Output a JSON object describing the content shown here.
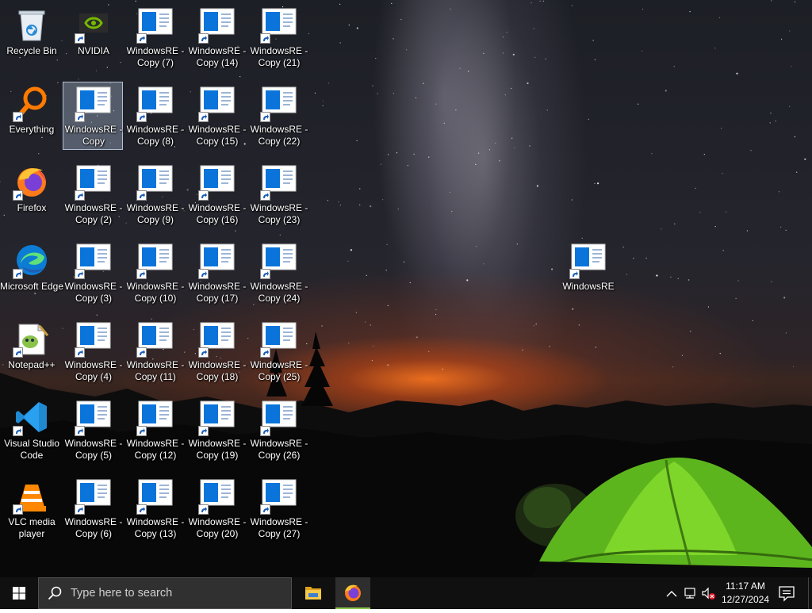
{
  "desktop": {
    "icons": [
      {
        "label": "Recycle Bin",
        "type": "recycle-bin"
      },
      {
        "label": "Everything",
        "type": "everything"
      },
      {
        "label": "Firefox",
        "type": "firefox"
      },
      {
        "label": "Microsoft Edge",
        "type": "edge"
      },
      {
        "label": "Notepad++",
        "type": "notepadpp"
      },
      {
        "label": "Visual Studio Code",
        "type": "vscode"
      },
      {
        "label": "VLC media player",
        "type": "vlc"
      },
      {
        "label": "NVIDIA",
        "type": "nvidia"
      },
      {
        "label": "WindowsRE - Copy",
        "type": "winre",
        "selected": true
      },
      {
        "label": "WindowsRE - Copy (2)",
        "type": "winre"
      },
      {
        "label": "WindowsRE - Copy (3)",
        "type": "winre"
      },
      {
        "label": "WindowsRE - Copy (4)",
        "type": "winre"
      },
      {
        "label": "WindowsRE - Copy (5)",
        "type": "winre"
      },
      {
        "label": "WindowsRE - Copy (6)",
        "type": "winre"
      },
      {
        "label": "WindowsRE - Copy (7)",
        "type": "winre"
      },
      {
        "label": "WindowsRE - Copy (8)",
        "type": "winre"
      },
      {
        "label": "WindowsRE - Copy (9)",
        "type": "winre"
      },
      {
        "label": "WindowsRE - Copy (10)",
        "type": "winre"
      },
      {
        "label": "WindowsRE - Copy (11)",
        "type": "winre"
      },
      {
        "label": "WindowsRE - Copy (12)",
        "type": "winre"
      },
      {
        "label": "WindowsRE - Copy (13)",
        "type": "winre"
      },
      {
        "label": "WindowsRE - Copy (14)",
        "type": "winre"
      },
      {
        "label": "WindowsRE - Copy (15)",
        "type": "winre"
      },
      {
        "label": "WindowsRE - Copy (16)",
        "type": "winre"
      },
      {
        "label": "WindowsRE - Copy (17)",
        "type": "winre"
      },
      {
        "label": "WindowsRE - Copy (18)",
        "type": "winre"
      },
      {
        "label": "WindowsRE - Copy (19)",
        "type": "winre"
      },
      {
        "label": "WindowsRE - Copy (20)",
        "type": "winre"
      },
      {
        "label": "WindowsRE - Copy (21)",
        "type": "winre"
      },
      {
        "label": "WindowsRE - Copy (22)",
        "type": "winre"
      },
      {
        "label": "WindowsRE - Copy (23)",
        "type": "winre"
      },
      {
        "label": "WindowsRE - Copy (24)",
        "type": "winre"
      },
      {
        "label": "WindowsRE - Copy (25)",
        "type": "winre"
      },
      {
        "label": "WindowsRE - Copy (26)",
        "type": "winre"
      },
      {
        "label": "WindowsRE - Copy (27)",
        "type": "winre"
      },
      {
        "label": "WindowsRE",
        "type": "winre"
      }
    ]
  },
  "taskbar": {
    "start_icon": "windows-logo-icon",
    "search_placeholder": "Type here to search",
    "pinned": [
      {
        "name": "File Explorer",
        "icon": "folder-icon",
        "active": false
      },
      {
        "name": "Firefox",
        "icon": "firefox-icon",
        "active": true
      }
    ],
    "tray": {
      "icons": [
        "chevron-up-icon",
        "network-icon",
        "volume-muted-icon"
      ],
      "time": "11:17 AM",
      "date": "12/27/2024",
      "notification_icon": "action-center-icon"
    }
  },
  "colors": {
    "taskbar": "#101010",
    "search_box": "#303030",
    "selection": "#aabed7",
    "active_underline": "#8bc34a"
  }
}
